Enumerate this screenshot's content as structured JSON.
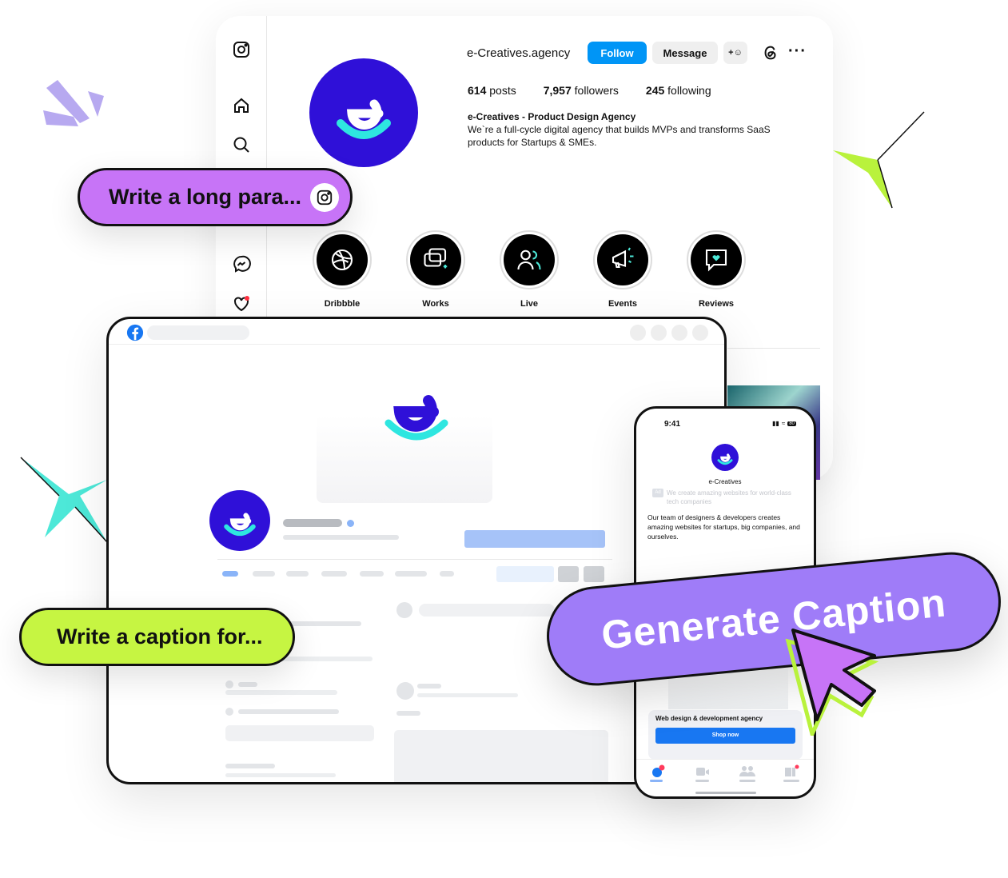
{
  "instagram": {
    "username": "e-Creatives.agency",
    "follow_label": "Follow",
    "message_label": "Message",
    "posts_count": "614",
    "posts_label": "posts",
    "followers_count": "7,957",
    "followers_label": "followers",
    "following_count": "245",
    "following_label": "following",
    "bio_title": "e-Creatives - Product Design Agency",
    "bio_text": "We`re a full-cycle digital agency that builds MVPs and transforms SaaS products for Startups & SMEs.",
    "highlights": [
      {
        "label": "Dribbble"
      },
      {
        "label": "Works"
      },
      {
        "label": "Live"
      },
      {
        "label": "Events"
      },
      {
        "label": "Reviews"
      }
    ],
    "sidebar_icons": [
      "instagram-icon",
      "home-icon",
      "search-icon",
      "reels-icon",
      "messenger-icon",
      "heart-icon"
    ]
  },
  "prompts": {
    "long_para": "Write a long para...",
    "caption_for": "Write a caption for...",
    "generate": "Generate Caption"
  },
  "phone": {
    "time": "9:41",
    "battery": "80",
    "page_name": "e-Creatives",
    "ad_badge": "Ad",
    "ad_subtitle": "We create amazing websites for world-class tech companies",
    "post_text": "Our team of designers & developers creates amazing websites for startups, big companies, and ourselves.",
    "cta_title": "Web design & development agency",
    "cta_button": "Shop now"
  },
  "colors": {
    "brand": "#2f10d8",
    "accent_cyan": "#2ee6e0",
    "follow": "#0095f6",
    "fb_blue": "#1877f2",
    "violet": "#c774f7",
    "purple": "#9f7cf8",
    "lime": "#c6f542",
    "teal": "#4de8d8"
  }
}
